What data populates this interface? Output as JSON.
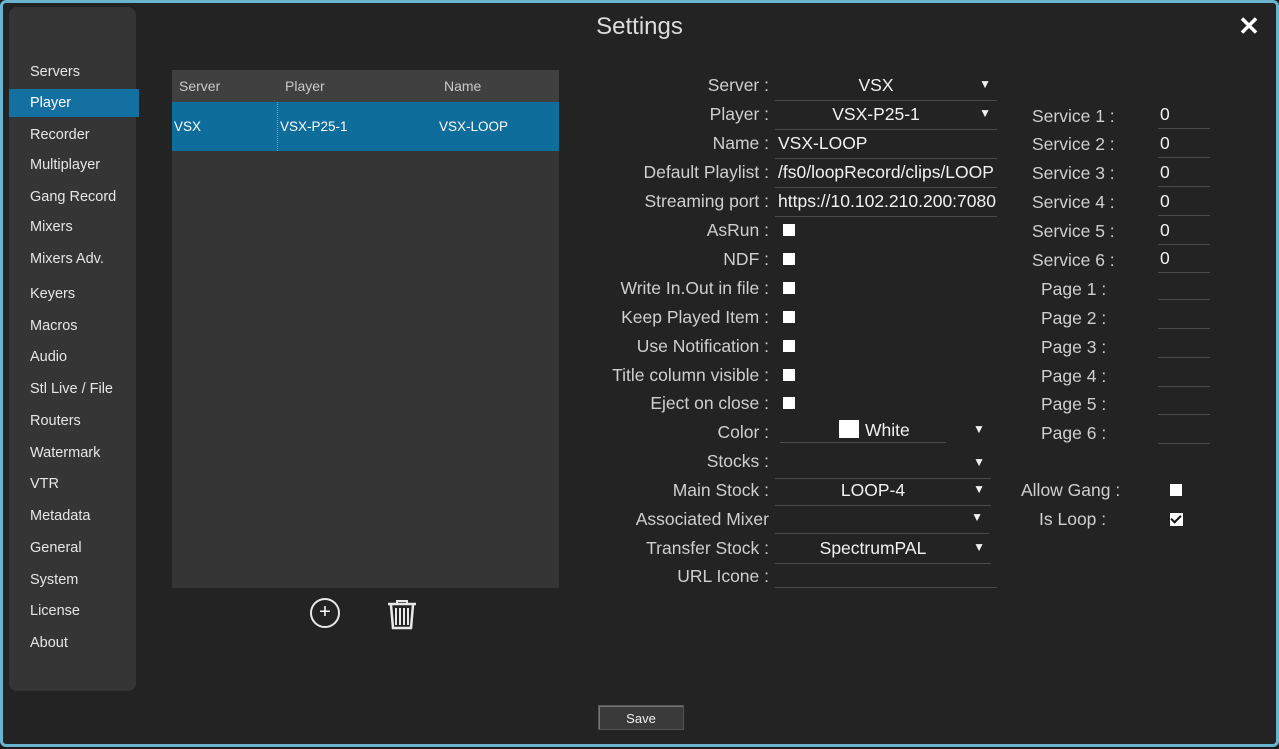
{
  "window": {
    "title": "Settings"
  },
  "sidebar": {
    "items": [
      {
        "label": "Servers"
      },
      {
        "label": "Player"
      },
      {
        "label": "Recorder"
      },
      {
        "label": "Multiplayer"
      },
      {
        "label": "Gang Record"
      },
      {
        "label": "Mixers"
      },
      {
        "label": "Mixers Adv."
      },
      {
        "label": "Keyers"
      },
      {
        "label": "Macros"
      },
      {
        "label": "Audio"
      },
      {
        "label": "Stl Live / File"
      },
      {
        "label": "Routers"
      },
      {
        "label": "Watermark"
      },
      {
        "label": "VTR"
      },
      {
        "label": "Metadata"
      },
      {
        "label": "General"
      },
      {
        "label": "System"
      },
      {
        "label": "License"
      },
      {
        "label": "About"
      }
    ],
    "active": "Player"
  },
  "grid": {
    "columns": [
      "Server",
      "Player",
      "Name"
    ],
    "rows": [
      {
        "server": "VSX",
        "player": "VSX-P25-1",
        "name": "VSX-LOOP"
      }
    ]
  },
  "form": {
    "server": {
      "label": "Server :",
      "value": "VSX"
    },
    "player": {
      "label": "Player :",
      "value": "VSX-P25-1"
    },
    "name": {
      "label": "Name :",
      "value": "VSX-LOOP"
    },
    "default_playlist": {
      "label": "Default Playlist :",
      "value": "/fs0/loopRecord/clips/LOOP"
    },
    "streaming_port": {
      "label": "Streaming port :",
      "value": "https://10.102.210.200:7080"
    },
    "asrun": {
      "label": "AsRun :",
      "checked": false
    },
    "ndf": {
      "label": "NDF :",
      "checked": false
    },
    "write_inout": {
      "label": "Write In.Out in file :",
      "checked": false
    },
    "keep_played": {
      "label": "Keep Played Item :",
      "checked": false
    },
    "use_notification": {
      "label": "Use Notification :",
      "checked": false
    },
    "title_column": {
      "label": "Title column visible :",
      "checked": false
    },
    "eject_on_close": {
      "label": "Eject on close :",
      "checked": false
    },
    "color": {
      "label": "Color :",
      "value": "White",
      "swatch": "#ffffff"
    },
    "stocks": {
      "label": "Stocks :",
      "value": ""
    },
    "main_stock": {
      "label": "Main Stock :",
      "value": "LOOP-4"
    },
    "associated_mixer": {
      "label": "Associated Mixer",
      "value": ""
    },
    "transfer_stock": {
      "label": "Transfer Stock :",
      "value": "SpectrumPAL"
    },
    "url_icone": {
      "label": "URL Icone :",
      "value": ""
    }
  },
  "services": [
    {
      "label": "Service 1 :",
      "value": "0"
    },
    {
      "label": "Service 2 :",
      "value": "0"
    },
    {
      "label": "Service 3 :",
      "value": "0"
    },
    {
      "label": "Service 4 :",
      "value": "0"
    },
    {
      "label": "Service 5 :",
      "value": "0"
    },
    {
      "label": "Service 6 :",
      "value": "0"
    }
  ],
  "pages": [
    {
      "label": "Page 1 :",
      "value": ""
    },
    {
      "label": "Page 2 :",
      "value": ""
    },
    {
      "label": "Page 3 :",
      "value": ""
    },
    {
      "label": "Page 4 :",
      "value": ""
    },
    {
      "label": "Page 5 :",
      "value": ""
    },
    {
      "label": "Page 6 :",
      "value": ""
    }
  ],
  "allow_gang": {
    "label": "Allow Gang :",
    "checked": false
  },
  "is_loop": {
    "label": "Is Loop :",
    "checked": true
  },
  "footer": {
    "save_label": "Save"
  },
  "icons": {
    "close": "close-icon",
    "add": "plus-circle-icon",
    "delete": "trash-icon",
    "dropdown": "caret-down-icon"
  },
  "colors": {
    "accent": "#1570a2",
    "border": "#6bb4cf"
  }
}
